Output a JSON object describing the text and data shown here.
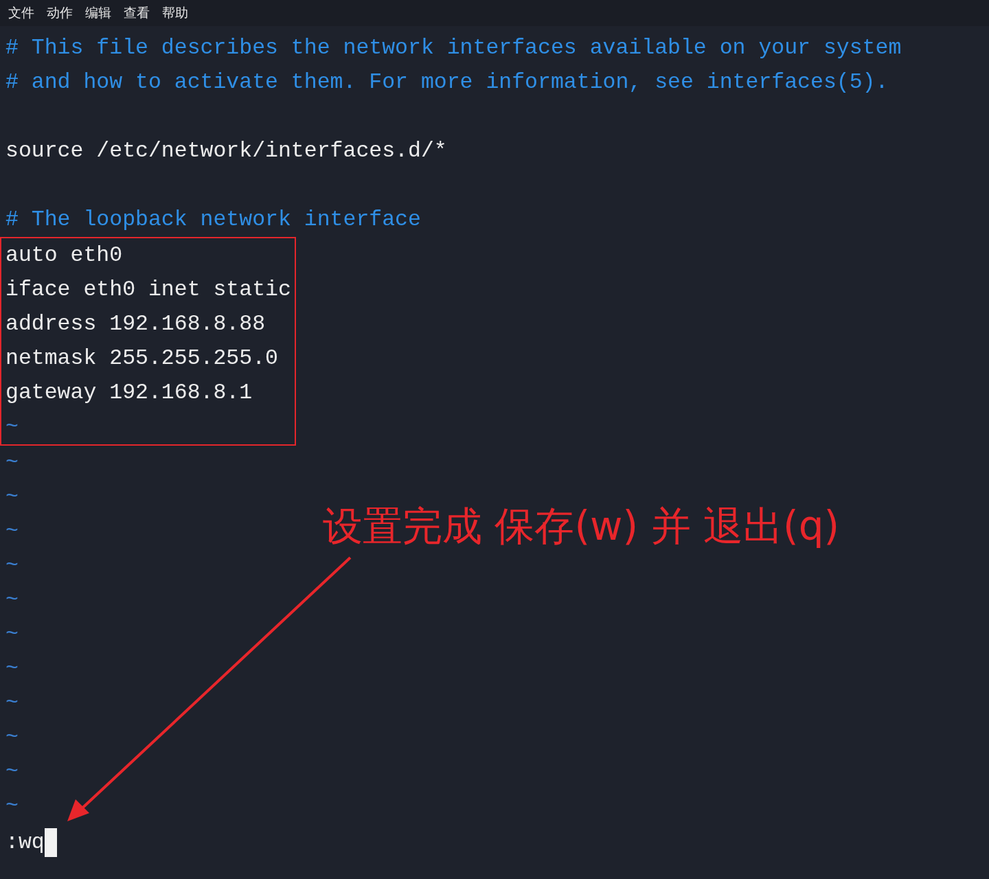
{
  "menu": [
    "文件",
    "动作",
    "编辑",
    "查看",
    "帮助"
  ],
  "blocks": [
    {
      "boxed": false,
      "lines": [
        {
          "kind": "comment",
          "text": "# This file describes the network interfaces available on your system"
        },
        {
          "kind": "comment",
          "text": "# and how to activate them. For more information, see interfaces(5)."
        },
        {
          "kind": "blank"
        },
        {
          "kind": "text",
          "text": "source /etc/network/interfaces.d/*"
        },
        {
          "kind": "blank"
        },
        {
          "kind": "comment",
          "text": "# The loopback network interface"
        }
      ]
    },
    {
      "boxed": true,
      "lines": [
        {
          "kind": "text",
          "text": "auto eth0"
        },
        {
          "kind": "text",
          "text": "iface eth0 inet static"
        },
        {
          "kind": "text",
          "text": "address 192.168.8.88"
        },
        {
          "kind": "text",
          "text": "netmask 255.255.255.0"
        },
        {
          "kind": "text",
          "text": "gateway 192.168.8.1"
        },
        {
          "kind": "tilde",
          "text": "~"
        }
      ]
    },
    {
      "boxed": false,
      "lines": [
        {
          "kind": "tilde",
          "text": "~"
        },
        {
          "kind": "tilde",
          "text": "~"
        },
        {
          "kind": "tilde",
          "text": "~"
        },
        {
          "kind": "tilde",
          "text": "~"
        },
        {
          "kind": "tilde",
          "text": "~"
        },
        {
          "kind": "tilde",
          "text": "~"
        },
        {
          "kind": "tilde",
          "text": "~"
        },
        {
          "kind": "tilde",
          "text": "~"
        },
        {
          "kind": "tilde",
          "text": "~"
        },
        {
          "kind": "tilde",
          "text": "~"
        },
        {
          "kind": "tilde",
          "text": "~"
        }
      ]
    }
  ],
  "annotation": {
    "text": "设置完成 保存(w) 并 退出(q)"
  },
  "command_line": {
    "text": ":wq",
    "cursor": true
  }
}
